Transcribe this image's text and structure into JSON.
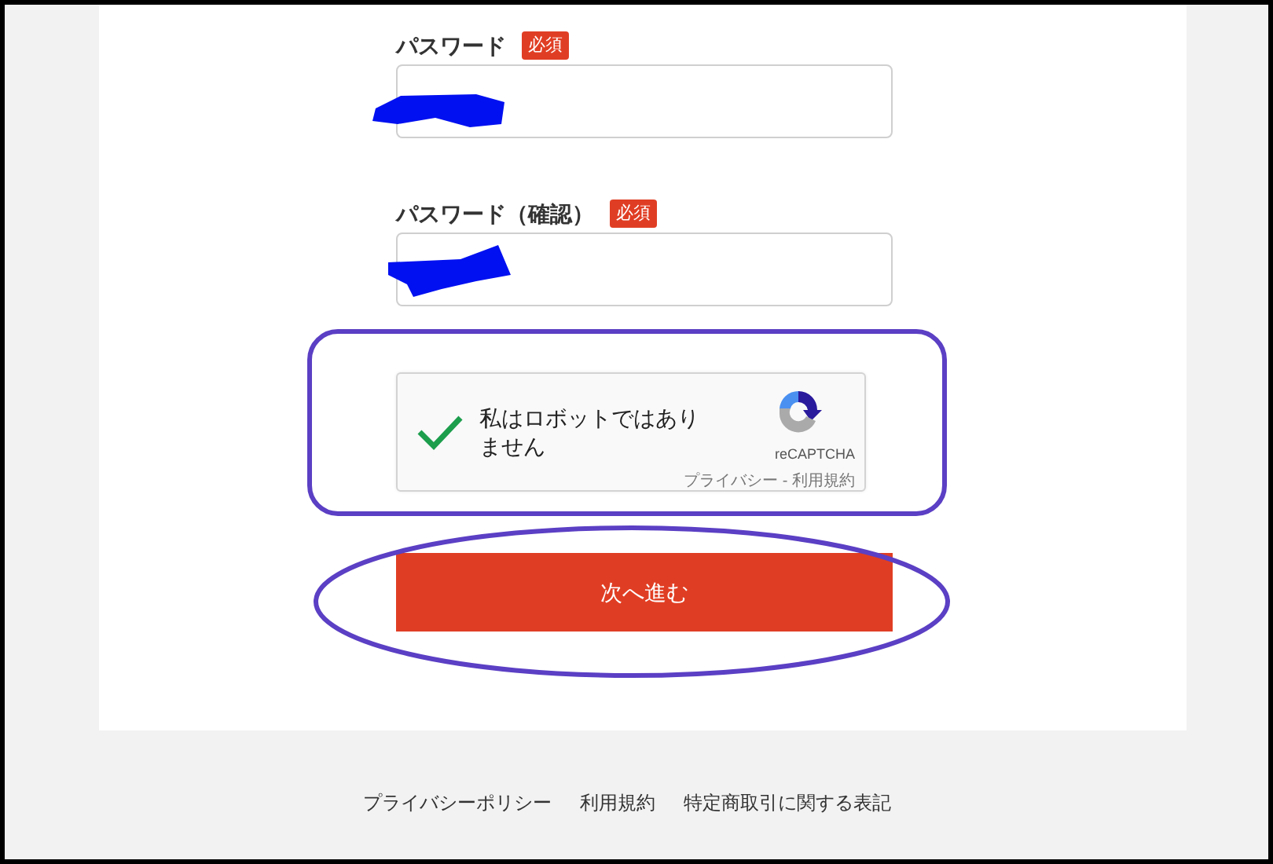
{
  "fields": [
    {
      "label": "パスワード",
      "badge": "必須"
    },
    {
      "label": "パスワード（確認）",
      "badge": "必須"
    }
  ],
  "captcha": {
    "checked": true,
    "label": "私はロボットではありません",
    "brand": "reCAPTCHA",
    "links": "プライバシー - 利用規約"
  },
  "submit_button": "次へ進む",
  "footer_links": [
    "プライバシーポリシー",
    "利用規約",
    "特定商取引に関する表記"
  ]
}
